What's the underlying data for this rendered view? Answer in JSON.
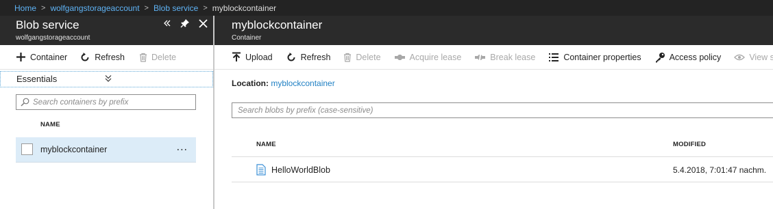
{
  "breadcrumb": {
    "items": [
      "Home",
      "wolfgangstorageaccount",
      "Blob service"
    ],
    "current": "myblockcontainer"
  },
  "left_blade": {
    "title": "Blob service",
    "subtitle": "wolfgangstorageaccount",
    "toolbar": {
      "container_label": "Container",
      "refresh_label": "Refresh",
      "delete_label": "Delete"
    },
    "essentials_label": "Essentials",
    "search_placeholder": "Search containers by prefix",
    "column_name": "NAME",
    "containers": [
      {
        "name": "myblockcontainer",
        "more": "..."
      }
    ]
  },
  "right_blade": {
    "title": "myblockcontainer",
    "subtitle": "Container",
    "toolbar": {
      "upload": "Upload",
      "refresh": "Refresh",
      "delete": "Delete",
      "acquire_lease": "Acquire lease",
      "break_lease": "Break lease",
      "container_properties": "Container properties",
      "access_policy": "Access policy",
      "view_snapshots": "View snapsh"
    },
    "location_label": "Location:",
    "location_value": "myblockcontainer",
    "search_placeholder": "Search blobs by prefix (case-sensitive)",
    "columns": {
      "name": "NAME",
      "modified": "MODIFIED"
    },
    "blobs": [
      {
        "name": "HelloWorldBlob",
        "modified": "5.4.2018, 7:01:47 nachm."
      }
    ]
  },
  "colors": {
    "header_bg": "#2b2b2b",
    "breadcrumb_bg": "#232323",
    "link": "#5fb3f5",
    "accent": "#1e7fc3",
    "selected_row": "#dcecf8"
  }
}
